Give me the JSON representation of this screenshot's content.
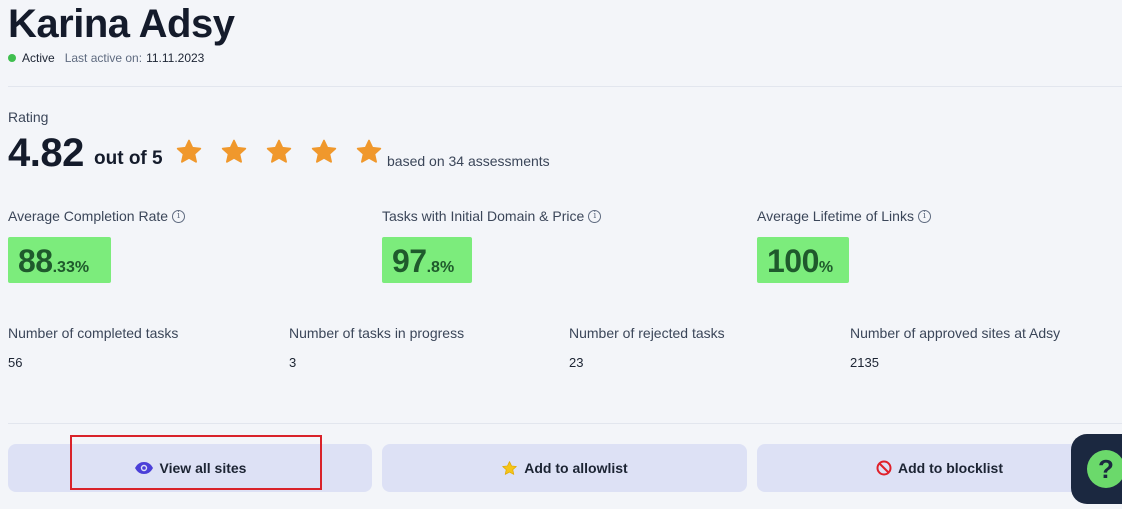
{
  "profile": {
    "name": "Karina Adsy",
    "status": "Active",
    "last_active_label": "Last active on:",
    "last_active_date": "11.11.2023"
  },
  "rating": {
    "label": "Rating",
    "value": "4.82",
    "out_of": "out of 5",
    "stars": 5,
    "based_on": "based on 34 assessments"
  },
  "metrics": [
    {
      "label": "Average Completion Rate",
      "whole": "88",
      "fraction": ".33%"
    },
    {
      "label": "Tasks with Initial Domain & Price",
      "whole": "97",
      "fraction": ".8%"
    },
    {
      "label": "Average Lifetime of Links",
      "whole": "100",
      "fraction": "%"
    }
  ],
  "stats": [
    {
      "label": "Number of completed tasks",
      "value": "56"
    },
    {
      "label": "Number of tasks in progress",
      "value": "3"
    },
    {
      "label": "Number of rejected tasks",
      "value": "23"
    },
    {
      "label": "Number of approved sites at Adsy",
      "value": "2135"
    }
  ],
  "actions": {
    "view_all_sites": "View all sites",
    "add_to_allowlist": "Add to allowlist",
    "add_to_blocklist": "Add to blocklist"
  },
  "help": {
    "icon": "question-icon",
    "glyph": "?"
  },
  "colors": {
    "metric_bg": "#7cec7c",
    "button_bg": "#dde1f5",
    "star": "#f0982c",
    "active_dot": "#3fbf4f",
    "highlight": "#d9222a"
  }
}
